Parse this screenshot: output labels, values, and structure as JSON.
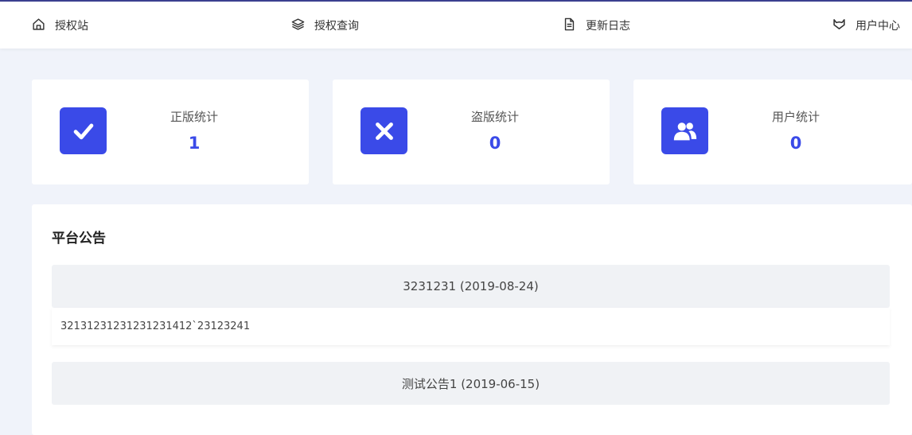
{
  "nav": {
    "items": [
      {
        "label": "授权站",
        "icon": "home-icon"
      },
      {
        "label": "授权查询",
        "icon": "layers-icon"
      },
      {
        "label": "更新日志",
        "icon": "document-icon"
      },
      {
        "label": "用户中心",
        "icon": "fox-icon"
      }
    ]
  },
  "stats": [
    {
      "label": "正版统计",
      "value": "1",
      "icon": "check-icon"
    },
    {
      "label": "盗版统计",
      "value": "0",
      "icon": "close-icon"
    },
    {
      "label": "用户统计",
      "value": "0",
      "icon": "users-icon"
    }
  ],
  "notices": {
    "title": "平台公告",
    "items": [
      {
        "heading": "3231231 (2019-08-24)",
        "content": "32131231231231231412`23123241"
      },
      {
        "heading": "测试公告1 (2019-06-15)",
        "content": ""
      }
    ]
  },
  "colors": {
    "accent": "#3a4ae8",
    "background": "#f0f3fa"
  }
}
